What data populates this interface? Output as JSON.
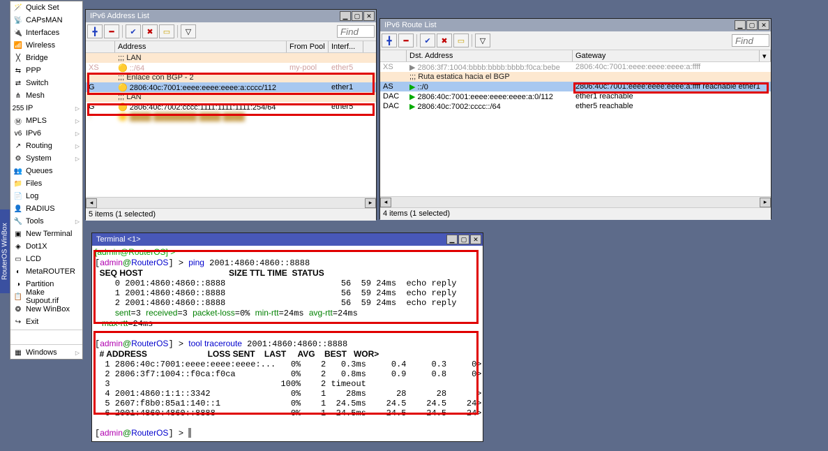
{
  "sidebar": {
    "items": [
      {
        "icon": "🪄",
        "label": "Quick Set"
      },
      {
        "icon": "📡",
        "label": "CAPsMAN"
      },
      {
        "icon": "🔌",
        "label": "Interfaces"
      },
      {
        "icon": "📶",
        "label": "Wireless"
      },
      {
        "icon": "╳",
        "label": "Bridge"
      },
      {
        "icon": "⇆",
        "label": "PPP"
      },
      {
        "icon": "⇄",
        "label": "Switch"
      },
      {
        "icon": "⋔",
        "label": "Mesh"
      },
      {
        "icon": "255",
        "label": "IP",
        "arrow": true
      },
      {
        "icon": "Ⓜ",
        "label": "MPLS",
        "arrow": true
      },
      {
        "icon": "v6",
        "label": "IPv6",
        "arrow": true
      },
      {
        "icon": "↗",
        "label": "Routing",
        "arrow": true
      },
      {
        "icon": "⚙",
        "label": "System",
        "arrow": true
      },
      {
        "icon": "👥",
        "label": "Queues"
      },
      {
        "icon": "📁",
        "label": "Files"
      },
      {
        "icon": "📄",
        "label": "Log"
      },
      {
        "icon": "👤",
        "label": "RADIUS"
      },
      {
        "icon": "🔧",
        "label": "Tools",
        "arrow": true
      },
      {
        "icon": "▣",
        "label": "New Terminal"
      },
      {
        "icon": "◈",
        "label": "Dot1X"
      },
      {
        "icon": "▭",
        "label": "LCD"
      },
      {
        "icon": "◐",
        "label": "MetaROUTER"
      },
      {
        "icon": "◑",
        "label": "Partition"
      },
      {
        "icon": "📋",
        "label": "Make Supout.rif"
      },
      {
        "icon": "❂",
        "label": "New WinBox"
      },
      {
        "icon": "↪",
        "label": "Exit"
      }
    ],
    "windows_label": "Windows"
  },
  "find_placeholder": "Find",
  "addr_win": {
    "title": "IPv6 Address List",
    "cols": {
      "address": "Address",
      "frompool": "From Pool",
      "iface": "Interf..."
    },
    "rows": [
      {
        "type": "comment",
        "text": ";;; LAN"
      },
      {
        "type": "faded",
        "flag": "XS",
        "addr": "::/64",
        "pool": "my-pool",
        "iface": "ether5"
      },
      {
        "type": "comment",
        "text": ";;; Enlace con BGP - 2",
        "sel": true
      },
      {
        "type": "row",
        "flag": "G",
        "icon": "🟡",
        "addr": "2806:40c:7001:eeee:eeee:eeee:a:cccc/112",
        "iface": "ether1",
        "sel": true
      },
      {
        "type": "comment",
        "text": ";;; LAN"
      },
      {
        "type": "row",
        "flag": "G",
        "icon": "🟡",
        "addr": "2806:40c:7002:cccc:1111:1111:1111:254/64",
        "iface": "ether5"
      }
    ],
    "status": "5 items (1 selected)"
  },
  "route_win": {
    "title": "IPv6 Route List",
    "cols": {
      "dst": "Dst. Address",
      "gw": "Gateway"
    },
    "rows": [
      {
        "flag": "XS",
        "icon": "▶",
        "dst": "2806:3f7:1004:bbbb:bbbb:bbbb:f0ca:bebe",
        "gw": "2806:40c:7001:eeee:eeee:eeee:a:ffff"
      },
      {
        "type": "comment",
        "text": ";;; Ruta estatica hacia el BGP"
      },
      {
        "flag": "AS",
        "icon": "▶",
        "dst": "::/0",
        "gw": "2806:40c:7001:eeee:eeee:eeee:a:ffff reachable ether1",
        "sel": true
      },
      {
        "flag": "DAC",
        "icon": "▶",
        "dst": "2806:40c:7001:eeee:eeee:eeee:a:0/112",
        "gw": "ether1 reachable"
      },
      {
        "flag": "DAC",
        "icon": "▶",
        "dst": "2806:40c:7002:cccc::/64",
        "gw": "ether5 reachable"
      }
    ],
    "status": "4 items (1 selected)"
  },
  "term_win": {
    "title": "Terminal <1>",
    "prompt_open": "[",
    "user": "admin",
    "at": "@",
    "host": "RouterOS",
    "prompt_close": "] > ",
    "cmd1": "ping",
    "arg1": "2001:4860:4860::8888",
    "ping_header": "  SEQ HOST                                     SIZE TTL TIME  STATUS",
    "ping_lines": [
      "    0 2001:4860:4860::8888                       56  59 24ms  echo reply",
      "    1 2001:4860:4860::8888                       56  59 24ms  echo reply",
      "    2 2001:4860:4860::8888                       56  59 24ms  echo reply"
    ],
    "ping_sum_pre": "    ",
    "ping_sum": {
      "sent": "sent",
      "sentv": "=3 ",
      "recv": "received",
      "recvv": "=3 ",
      "pl": "packet-loss",
      "plv": "=0% ",
      "min": "min-rtt",
      "minv": "=24ms ",
      "avg": "avg-rtt",
      "avgv": "=24ms",
      "max": "max-rtt",
      "maxv": "=24ms"
    },
    "cmd2a": "tool ",
    "cmd2b": "traceroute",
    "arg2": "2001:4860:4860::8888",
    "tr_header": "  # ADDRESS                          LOSS SENT    LAST     AVG    BEST   WOR>",
    "tr_lines": [
      "  1 2806:40c:7001:eeee:eeee:eeee:...   0%    2   0.3ms     0.4     0.3     0>",
      "  2 2806:3f7:1004::f0ca:f0ca           0%    2   0.8ms     0.9     0.8     0>",
      "  3                                  100%    2 timeout",
      "  4 2001:4860:1:1::3342                0%    1    28ms      28      28      >",
      "  5 2607:f8b0:85a1:140::1              0%    1  24.5ms    24.5    24.5    24>",
      "  6 2001:4860:4860::8888               0%    1  24.5ms    24.5    24.5    24>"
    ]
  },
  "sidetab": "RouterOS WinBox"
}
